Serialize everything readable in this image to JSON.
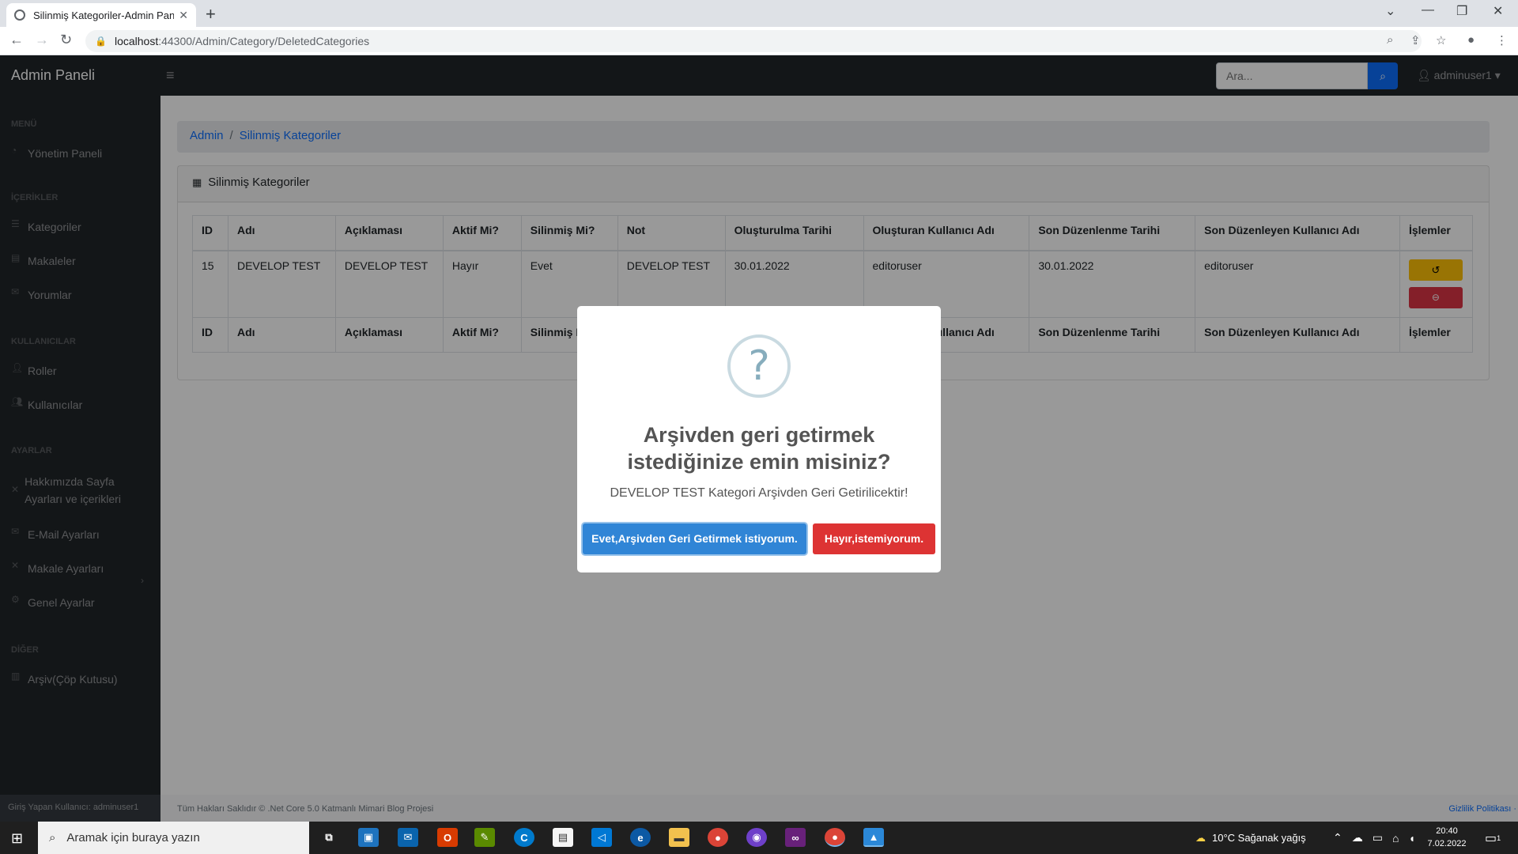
{
  "browser": {
    "tab_title": "Silinmiş Kategoriler-Admin Paneli",
    "url_host": "localhost",
    "url_path": ":44300/Admin/Category/DeletedCategories"
  },
  "navbar": {
    "brand": "Admin Paneli",
    "search_placeholder": "Ara...",
    "user": "adminuser1"
  },
  "sidebar": {
    "headings": [
      "MENÜ",
      "İÇERİKLER",
      "KULLANICILAR",
      "AYARLAR",
      "DİĞER"
    ],
    "items": [
      {
        "label": "Yönetim Paneli",
        "icon": "dashboard-icon"
      },
      {
        "label": "Kategoriler",
        "icon": "list-icon"
      },
      {
        "label": "Makaleler",
        "icon": "file-icon"
      },
      {
        "label": "Yorumlar",
        "icon": "comments-icon"
      },
      {
        "label": "Roller",
        "icon": "user-tag-icon"
      },
      {
        "label": "Kullanıcılar",
        "icon": "users-icon"
      },
      {
        "label": "Hakkımızda Sayfa Ayarları ve içerikleri",
        "icon": "tools-icon"
      },
      {
        "label": "E-Mail Ayarları",
        "icon": "envelope-icon"
      },
      {
        "label": "Makale Ayarları",
        "icon": "tools-icon"
      },
      {
        "label": "Genel Ayarlar",
        "icon": "cog-icon"
      },
      {
        "label": "Arşiv(Çöp Kutusu)",
        "icon": "trash-icon"
      }
    ],
    "footer": "Giriş Yapan Kullanıcı: adminuser1"
  },
  "breadcrumb": {
    "root": "Admin",
    "current": "Silinmiş Kategoriler"
  },
  "card": {
    "title": "Silinmiş Kategoriler"
  },
  "table": {
    "headers": [
      "ID",
      "Adı",
      "Açıklaması",
      "Aktif Mi?",
      "Silinmiş Mi?",
      "Not",
      "Oluşturulma Tarihi",
      "Oluşturan Kullanıcı Adı",
      "Son Düzenlenme Tarihi",
      "Son Düzenleyen Kullanıcı Adı",
      "İşlemler"
    ],
    "rows": [
      [
        "15",
        "DEVELOP TEST",
        "DEVELOP TEST",
        "Hayır",
        "Evet",
        "DEVELOP TEST",
        "30.01.2022",
        "editoruser",
        "30.01.2022",
        "editoruser"
      ]
    ]
  },
  "footer": {
    "copyright": "Tüm Hakları Saklıdır © .Net Core 5.0 Katmanlı Mimari Blog Projesi",
    "privacy": "Gizlilik Politikası ·"
  },
  "modal": {
    "icon": "?",
    "title": "Arşivden geri getirmek istediğinize emin misiniz?",
    "text": "DEVELOP TEST Kategori Arşivden Geri Getirilicektir!",
    "confirm": "Evet,Arşivden Geri Getirmek istiyorum.",
    "cancel": "Hayır,istemiyorum."
  },
  "taskbar": {
    "search_placeholder": "Aramak için buraya yazın",
    "weather": "10°C  Sağanak yağış",
    "time": "20:40",
    "date": "7.02.2022",
    "notifications": "1"
  },
  "colors": {
    "navbar": "#212529",
    "primary": "#0d6efd",
    "warning": "#ffc107",
    "danger": "#dc3545",
    "swal_confirm": "#3085d6",
    "swal_cancel": "#dd3333"
  }
}
